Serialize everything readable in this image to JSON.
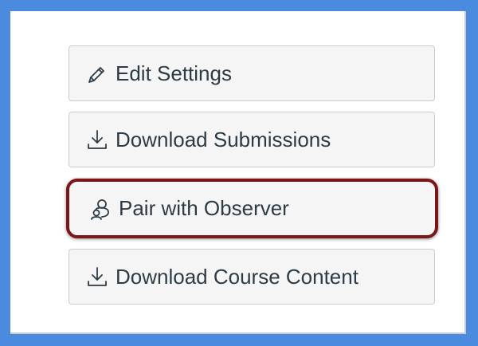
{
  "actions": {
    "edit_settings": {
      "label": "Edit Settings",
      "icon": "pencil-icon"
    },
    "download_submissions": {
      "label": "Download Submissions",
      "icon": "download-icon"
    },
    "pair_with_observer": {
      "label": "Pair with Observer",
      "icon": "observer-icon",
      "highlight_color": "#7a1518"
    },
    "download_course_content": {
      "label": "Download Course Content",
      "icon": "download-icon"
    }
  },
  "colors": {
    "frame": "#4a8be0",
    "button_bg": "#f5f5f5",
    "button_border": "#c7cdd1",
    "text": "#2d3b45"
  }
}
